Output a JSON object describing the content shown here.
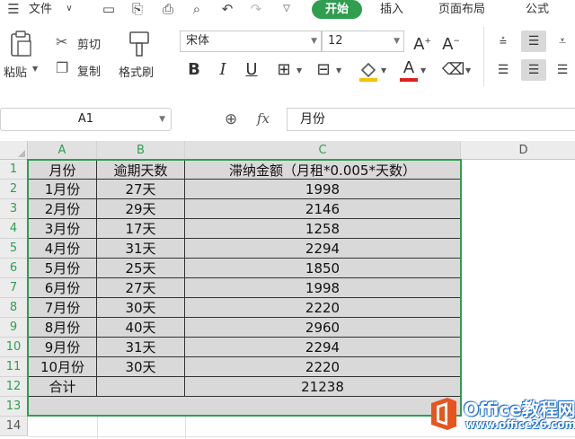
{
  "menu": {
    "file_label": "文件",
    "tabs": [
      "开始",
      "插入",
      "页面布局",
      "公式"
    ],
    "active_tab": "开始"
  },
  "ribbon": {
    "paste_label": "粘贴",
    "cut_label": "剪切",
    "copy_label": "复制",
    "format_painter_label": "格式刷",
    "font_name": "宋体",
    "font_size": "12"
  },
  "formula_bar": {
    "name_box": "A1",
    "fx_label": "fx",
    "content": "月份"
  },
  "sheet": {
    "columns": [
      "A",
      "B",
      "C",
      "D"
    ],
    "rows": [
      "1",
      "2",
      "3",
      "4",
      "5",
      "6",
      "7",
      "8",
      "9",
      "10",
      "11",
      "12",
      "13",
      "14"
    ],
    "header": [
      "月份",
      "逾期天数",
      "滞纳金额（月租*0.005*天数）"
    ],
    "data": [
      [
        "1月份",
        "27天",
        "1998"
      ],
      [
        "2月份",
        "29天",
        "2146"
      ],
      [
        "3月份",
        "17天",
        "1258"
      ],
      [
        "4月份",
        "31天",
        "2294"
      ],
      [
        "5月份",
        "25天",
        "1850"
      ],
      [
        "6月份",
        "27天",
        "1998"
      ],
      [
        "7月份",
        "30天",
        "2220"
      ],
      [
        "8月份",
        "40天",
        "2960"
      ],
      [
        "9月份",
        "31天",
        "2294"
      ],
      [
        "10月份",
        "30天",
        "2220"
      ]
    ],
    "total": [
      "合计",
      "",
      "21238"
    ]
  },
  "watermark": {
    "title": "Office教程网",
    "url": "www.office26.com"
  },
  "colors": {
    "accent": "#2f9e4f",
    "selection": "#d9d9d9",
    "watermark": "#1e6fd0",
    "logo": "#e8541e"
  }
}
